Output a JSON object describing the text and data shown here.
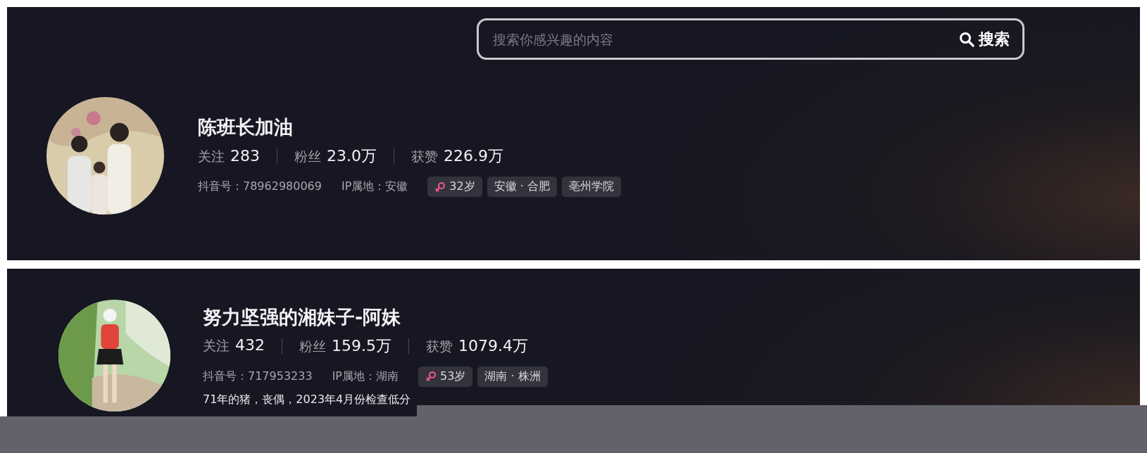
{
  "search": {
    "placeholder": "搜索你感兴趣的内容",
    "button": "搜索"
  },
  "profiles": [
    {
      "name": "陈班长加油",
      "stats": [
        {
          "label": "关注",
          "value": "283"
        },
        {
          "label": "粉丝",
          "value": "23.0万"
        },
        {
          "label": "获赞",
          "value": "226.9万"
        }
      ],
      "account": "抖音号：78962980069",
      "ip": "IP属地：安徽",
      "tags": [
        {
          "kind": "age",
          "text": "32岁"
        },
        {
          "kind": "plain",
          "text": "安徽 · 合肥"
        },
        {
          "kind": "plain",
          "text": "亳州学院"
        }
      ]
    },
    {
      "name": "努力坚强的湘妹子-阿妹",
      "stats": [
        {
          "label": "关注",
          "value": "432"
        },
        {
          "label": "粉丝",
          "value": "159.5万"
        },
        {
          "label": "获赞",
          "value": "1079.4万"
        }
      ],
      "account": "抖音号：717953233",
      "ip": "IP属地：湖南",
      "tags": [
        {
          "kind": "age",
          "text": "53岁"
        },
        {
          "kind": "plain",
          "text": "湖南 · 株洲"
        }
      ],
      "bio": "71年的猪，丧偶，2023年4月份检查低分"
    }
  ]
}
